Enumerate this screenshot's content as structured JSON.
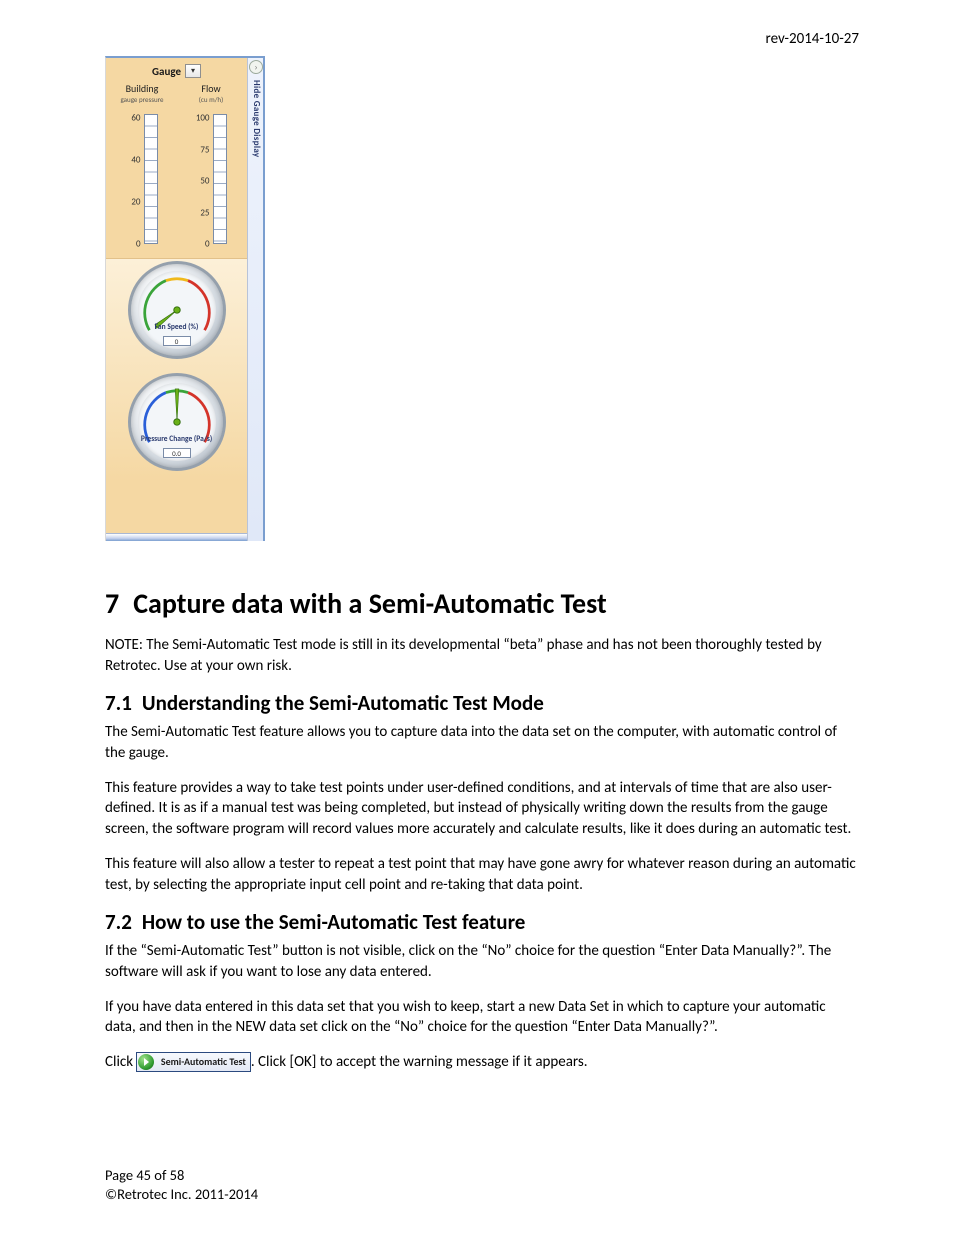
{
  "header": {
    "revision": "rev-2014-10-27"
  },
  "panel": {
    "gauge_label": "Gauge",
    "hide_side_text": "Hide Gauge Display",
    "bars": [
      {
        "title": "Building",
        "subtitle": "gauge pressure",
        "ticks": [
          "60",
          "40",
          "20",
          "0"
        ]
      },
      {
        "title": "Flow",
        "subtitle": "(cu m/h)",
        "ticks": [
          "100",
          "75",
          "50",
          "25",
          "0"
        ]
      }
    ],
    "dials": [
      {
        "label": "Fan Speed (%)",
        "readout": "0"
      },
      {
        "label": "Pressure Change (Pa/s)",
        "readout": "0.0"
      }
    ]
  },
  "doc": {
    "h1_num": "7",
    "h1_text": "Capture data with a Semi-Automatic Test",
    "note": "NOTE:  The Semi-Automatic Test mode is still in its developmental “beta” phase and has not been thoroughly tested by Retrotec.  Use at your own risk.",
    "h2a_num": "7.1",
    "h2a_text": "Understanding the Semi-Automatic Test Mode",
    "p1": "The Semi-Automatic Test feature allows you to capture data into the data set on the computer, with automatic control of the gauge.",
    "p2": "This feature provides a way to take test points under user-defined conditions, and at intervals of time that are also user-defined.  It is as if a manual test was being completed, but instead of physically writing down the results from the gauge screen, the software program will record values more accurately and calculate results, like it does during an automatic test.",
    "p3": "This feature will also allow a tester to repeat a test point that may have gone awry for whatever reason during an automatic test, by selecting the appropriate input cell point and re-taking that data point.",
    "h2b_num": "7.2",
    "h2b_text": "How to use the Semi-Automatic Test feature",
    "p4": "If the “Semi-Automatic Test” button is not visible, click on the “No” choice for the question “Enter Data Manually?”.  The software will ask if you want to lose any data entered.",
    "p5": "If you have data entered in this data set that you wish to keep, start a new Data Set in which to capture your automatic data, and then in the NEW data set click on the “No” choice for the question “Enter Data Manually?”.",
    "p6_pre": "Click ",
    "inline_button_text": "Semi-Automatic Test",
    "p6_post": ".  Click [OK] to accept the warning message if it appears."
  },
  "footer": {
    "page": "Page 45 of 58",
    "copyright": "©Retrotec Inc. 2011-2014"
  }
}
